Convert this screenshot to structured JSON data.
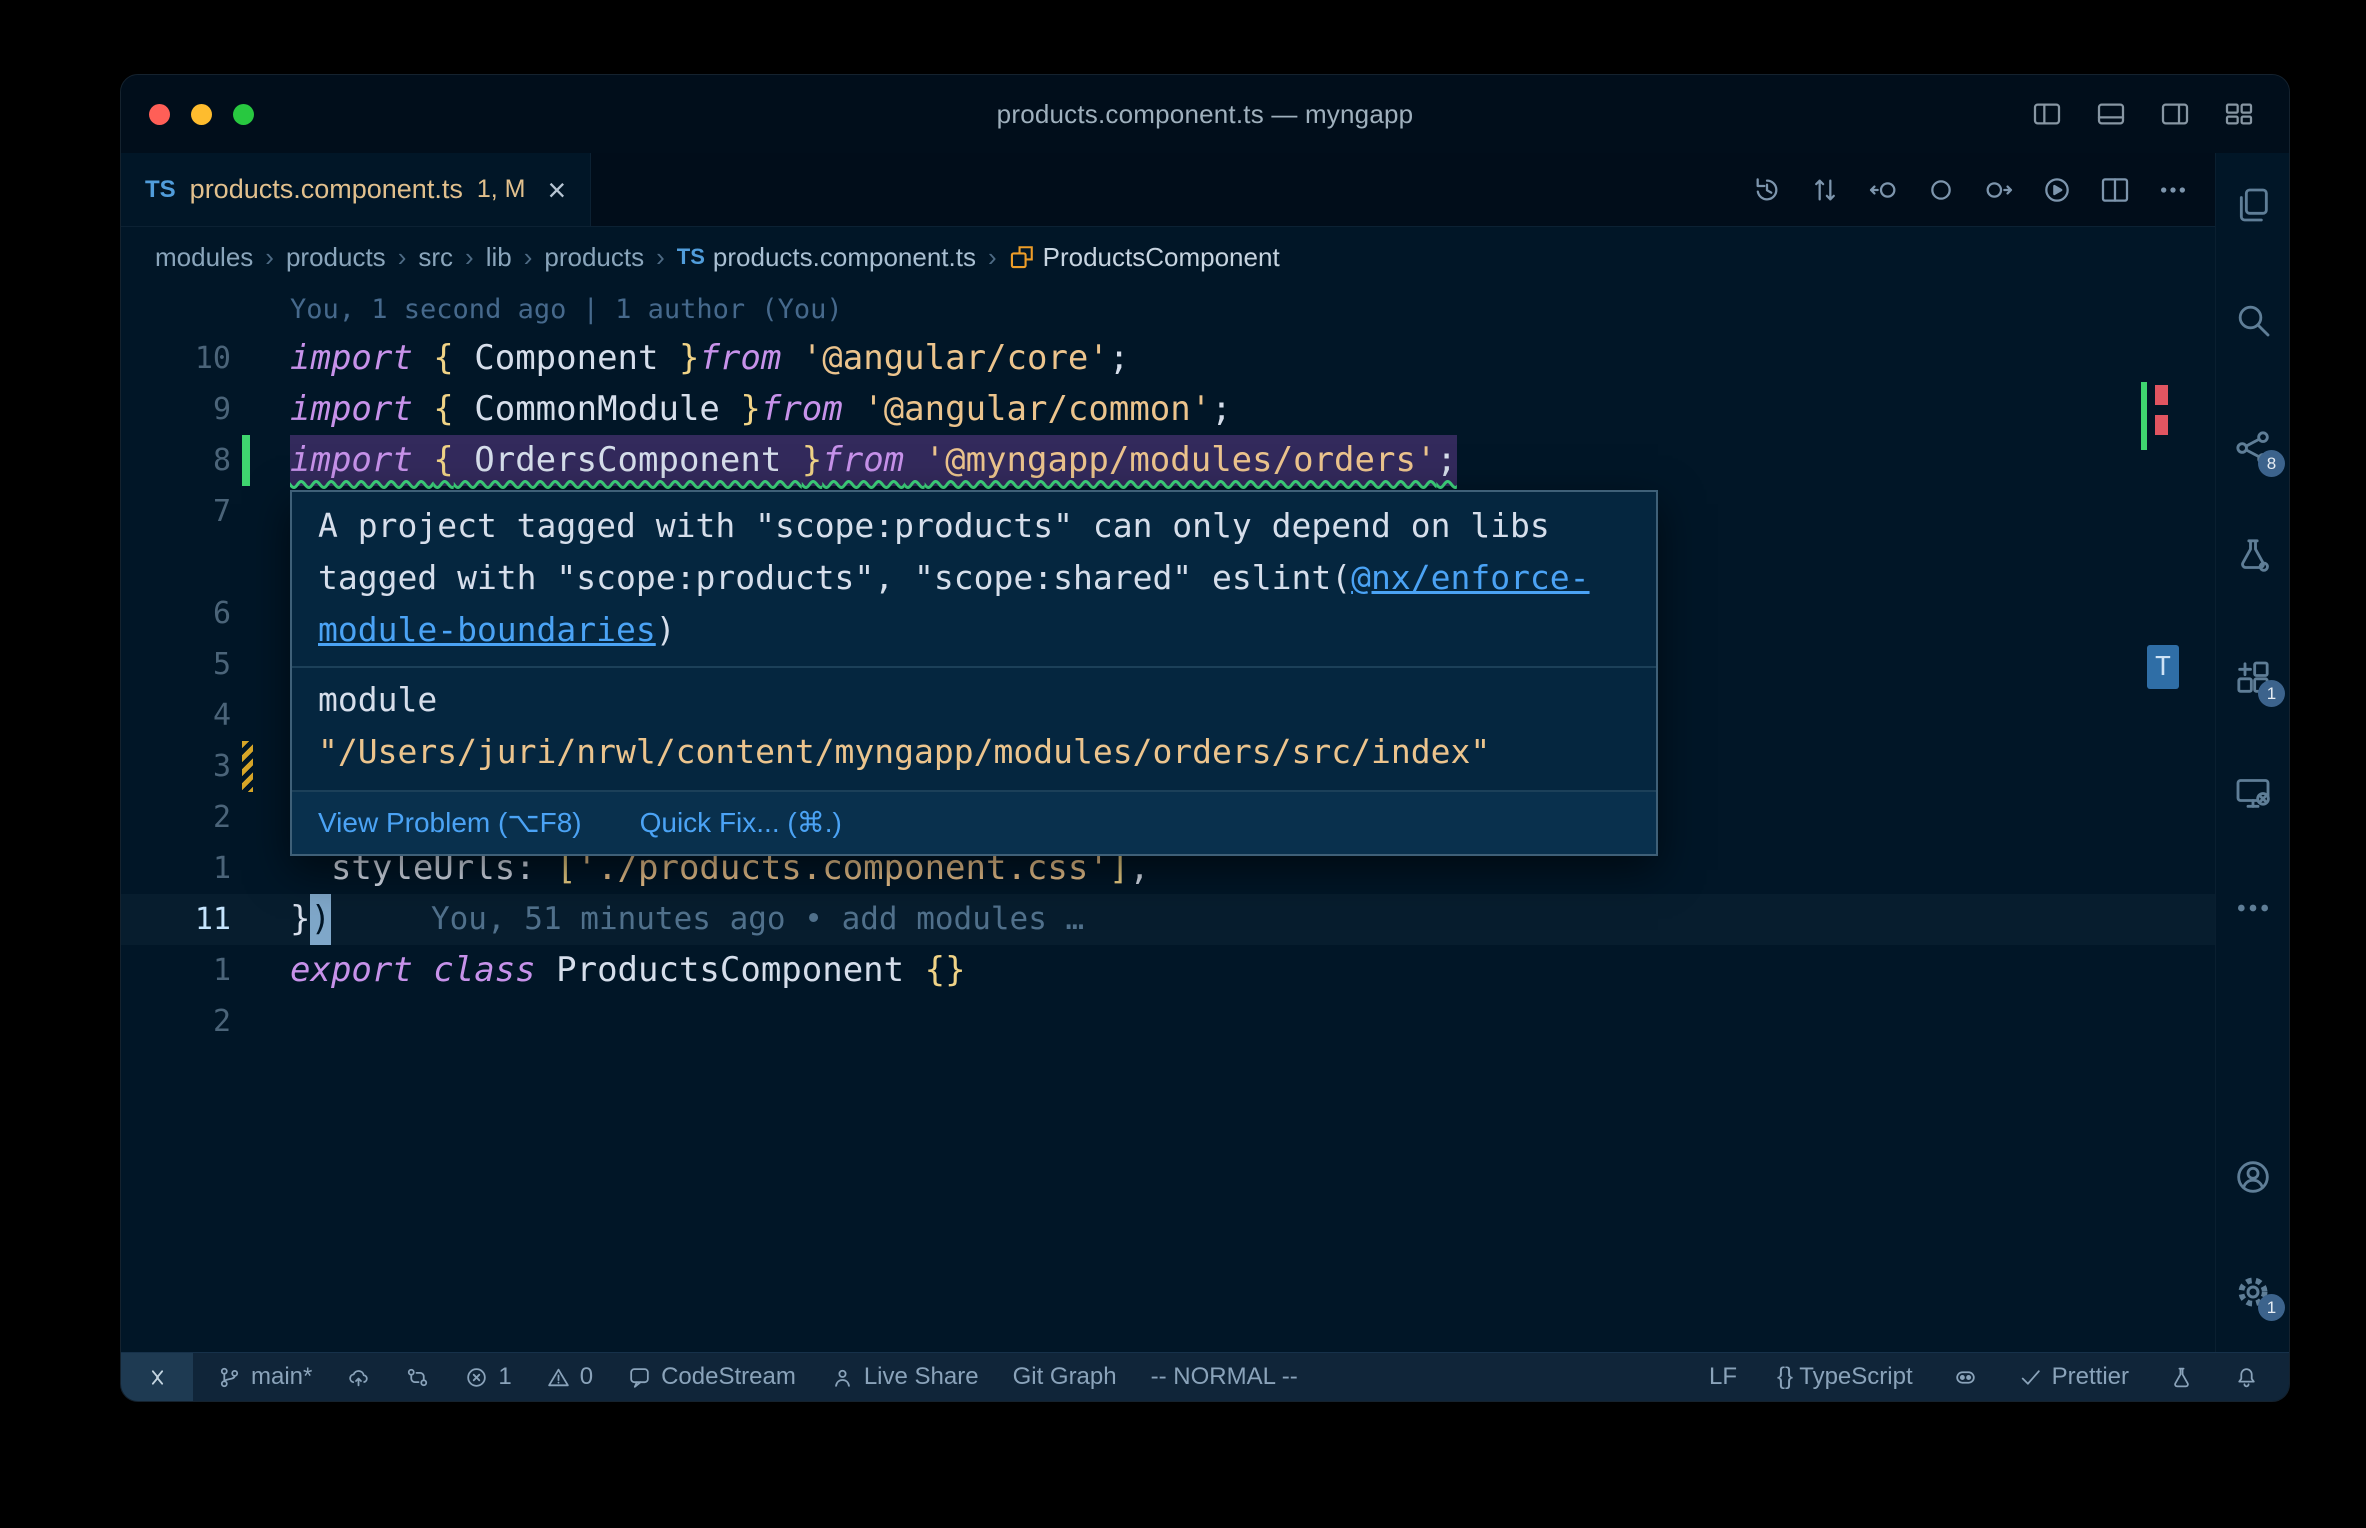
{
  "window": {
    "title": "products.component.ts — myngapp"
  },
  "titlebar": {
    "layout_buttons": [
      {
        "name": "toggle-left-sidebar",
        "icon": "layout-left"
      },
      {
        "name": "toggle-panel",
        "icon": "layout-bottom"
      },
      {
        "name": "toggle-right-sidebar",
        "icon": "layout-right"
      },
      {
        "name": "customize-layout",
        "icon": "layout-grid"
      }
    ]
  },
  "tab": {
    "file_icon": "TS",
    "label": "products.component.ts",
    "decorations": "1, M",
    "close_glyph": "×"
  },
  "editor_actions": [
    {
      "name": "timeline-history",
      "icon": "history"
    },
    {
      "name": "open-changes",
      "icon": "pr"
    },
    {
      "name": "previous-change",
      "icon": "prev"
    },
    {
      "name": "gitlens-annotations",
      "icon": "circle"
    },
    {
      "name": "next-change",
      "icon": "next"
    },
    {
      "name": "run-file",
      "icon": "play-circle"
    },
    {
      "name": "split-editor",
      "icon": "split"
    },
    {
      "name": "more-actions",
      "icon": "ellipsis"
    }
  ],
  "breadcrumbs": {
    "separator": "›",
    "items": [
      {
        "label": "modules"
      },
      {
        "label": "products"
      },
      {
        "label": "src"
      },
      {
        "label": "lib"
      },
      {
        "label": "products"
      },
      {
        "label": "products.component.ts",
        "icon": "ts"
      },
      {
        "label": "ProductsComponent",
        "icon": "class"
      }
    ]
  },
  "code": {
    "rows": [
      {
        "kind": "blame",
        "text": "You, 1 second ago | 1 author (You)"
      },
      {
        "num": "10",
        "tokens": [
          [
            "kw",
            "import "
          ],
          [
            "brace",
            "{"
          ],
          [
            "pl",
            " Component "
          ],
          [
            "brace",
            "}"
          ],
          [
            "kw",
            "from"
          ],
          [
            "pl",
            " "
          ],
          [
            "str",
            "'@angular/core'"
          ],
          [
            "pl",
            ";"
          ]
        ]
      },
      {
        "num": "9",
        "tokens": [
          [
            "kw",
            "import "
          ],
          [
            "brace",
            "{"
          ],
          [
            "pl",
            " CommonModule "
          ],
          [
            "brace",
            "}"
          ],
          [
            "kw",
            "from"
          ],
          [
            "pl",
            " "
          ],
          [
            "str",
            "'@angular/common'"
          ],
          [
            "pl",
            ";"
          ]
        ]
      },
      {
        "num": "8",
        "selected": true,
        "gutter": "added",
        "tokens": [
          [
            "kw",
            "import "
          ],
          [
            "brace",
            "{"
          ],
          [
            "pl",
            " OrdersComponent "
          ],
          [
            "brace",
            "}"
          ],
          [
            "kw",
            "from"
          ],
          [
            "pl",
            " "
          ],
          [
            "str",
            "'@myngapp/modules/orders'"
          ],
          [
            "pl",
            ";"
          ]
        ]
      },
      {
        "num": "7"
      },
      {
        "num": ""
      },
      {
        "num": "6"
      },
      {
        "num": "5"
      },
      {
        "num": "4"
      },
      {
        "num": "3",
        "gutter": "modified"
      },
      {
        "num": "2"
      },
      {
        "num": "1",
        "tokens": [
          [
            "pl",
            "  styleUrls: "
          ],
          [
            "brace",
            "["
          ],
          [
            "str",
            "'./products.component.css'"
          ],
          [
            "brace",
            "]"
          ],
          [
            "pl",
            ","
          ]
        ]
      },
      {
        "num": "11",
        "current": true,
        "tokens": [
          [
            "pl",
            "}"
          ],
          [
            "cursor",
            ")"
          ]
        ],
        "inline_blame": "You, 51 minutes ago • add modules …"
      },
      {
        "num": "1",
        "tokens": [
          [
            "kw",
            "export "
          ],
          [
            "kw",
            "class "
          ],
          [
            "pl",
            "ProductsComponent "
          ],
          [
            "brace",
            "{}"
          ]
        ]
      },
      {
        "num": "2"
      }
    ]
  },
  "hover": {
    "message_before": "A project tagged with \"scope:products\" can only depend on libs tagged with \"scope:products\", \"scope:shared\" eslint(",
    "link_label": "@nx/enforce-module-boundaries",
    "message_after": ")",
    "module_label": "module",
    "module_path": "\"/Users/juri/nrwl/content/myngapp/modules/orders/src/index\"",
    "view_problem_label": "View Problem (⌥F8)",
    "quick_fix_label": "Quick Fix... (⌘.)"
  },
  "overview": {
    "minimap_label": "T"
  },
  "activity_bar": {
    "items": [
      {
        "name": "explorer",
        "icon": "files"
      },
      {
        "name": "search",
        "icon": "search"
      },
      {
        "name": "source-control",
        "icon": "scm",
        "badge": "8"
      },
      {
        "name": "testing",
        "icon": "beaker"
      },
      {
        "name": "extensions",
        "icon": "extensions",
        "badge": "1"
      },
      {
        "name": "remote-explorer",
        "icon": "monitor"
      },
      {
        "name": "more-views",
        "icon": "ellipsis"
      },
      {
        "name": "accounts",
        "icon": "account"
      },
      {
        "name": "settings",
        "icon": "gear",
        "badge": "1"
      }
    ]
  },
  "status_bar": {
    "left": [
      {
        "name": "remote-indicator",
        "icon": "remote",
        "box": true
      },
      {
        "name": "git-branch",
        "icon": "branch",
        "label": "main*"
      },
      {
        "name": "publish-changes",
        "icon": "cloud-up"
      },
      {
        "name": "gitlens-compare",
        "icon": "compare"
      },
      {
        "name": "problems-errors",
        "icon": "error",
        "label": "1"
      },
      {
        "name": "problems-warnings",
        "icon": "warning",
        "label": "0"
      },
      {
        "name": "codestream",
        "icon": "codestream",
        "label": "CodeStream"
      },
      {
        "name": "live-share",
        "icon": "liveshare",
        "label": "Live Share"
      },
      {
        "name": "git-graph",
        "label": "Git Graph"
      },
      {
        "name": "vim-mode",
        "label": "-- NORMAL --"
      }
    ],
    "right": [
      {
        "name": "eol-sequence",
        "label": "LF"
      },
      {
        "name": "language-mode",
        "label": "{} TypeScript"
      },
      {
        "name": "copilot",
        "icon": "copilot"
      },
      {
        "name": "prettier",
        "icon": "check",
        "label": "Prettier"
      },
      {
        "name": "feedback",
        "icon": "flask"
      },
      {
        "name": "notifications",
        "icon": "bell"
      }
    ]
  },
  "theme": {
    "editor_bg": "#011627",
    "titlebar_bg": "#010e1b",
    "tabstrip_bg": "#010d1a",
    "statusbar_bg": "#102539",
    "popup_bg": "#05263f",
    "popup_border": "#3f6078",
    "foreground": "#d6deeb",
    "keyword": "#c792ea",
    "string": "#ecc48d",
    "brace": "#f0d386",
    "line_number": "#4b6479",
    "line_number_active": "#c5e4fd",
    "blame": "#46698c",
    "selection": "#332a5c",
    "squiggle": "#3fd97f",
    "gutter_added": "#3fd56f",
    "gutter_modified": "#d9a728",
    "cursor_bg": "#7fa7c9",
    "badge_bg": "#3c638c",
    "icon_fg": "#5f7e97",
    "statusbar_fg": "#8aa3ba",
    "tab_modified": "#e2c08d",
    "ts_blue": "#519ddb",
    "link": "#4ba3f5",
    "breadcrumb_fg": "#8aa5bb",
    "title_fg": "#9fb0bd",
    "class_icon": "#ee9d28",
    "traffic_red": "#ff5f57",
    "traffic_yellow": "#febc2e",
    "traffic_green": "#28c840"
  }
}
